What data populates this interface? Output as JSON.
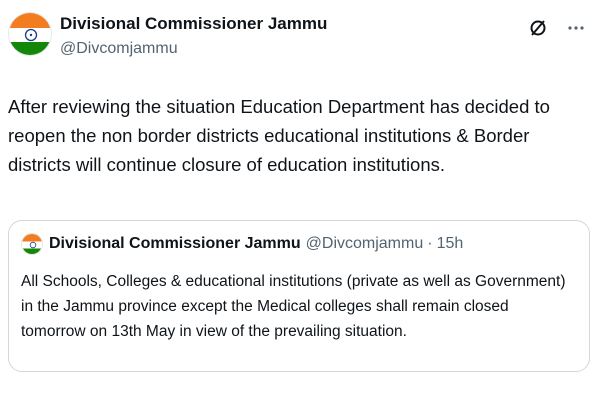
{
  "tweet": {
    "author": {
      "display_name": "Divisional Commissioner Jammu",
      "handle": "@Divcomjammu"
    },
    "text": "After reviewing the situation Education Department has decided to reopen the non border districts educational institutions & Border districts will continue closure of education institutions.",
    "actions": {
      "grok_icon": "slashed-circle-icon",
      "more_icon": "more-horizontal-icon"
    },
    "quote": {
      "display_name": "Divisional Commissioner Jammu",
      "handle": "@Divcomjammu",
      "separator": "·",
      "time": "15h",
      "text": "All Schools, Colleges & educational institutions (private as well as Government) in the Jammu province except the Medical colleges shall remain closed tomorrow on 13th May in view of the prevailing situation."
    }
  },
  "colors": {
    "text_primary": "#0f1419",
    "text_secondary": "#536471",
    "border": "#cfd9de",
    "flag_saffron": "#f47c20",
    "flag_green": "#138808",
    "flag_chakra": "#1a3a8a"
  }
}
